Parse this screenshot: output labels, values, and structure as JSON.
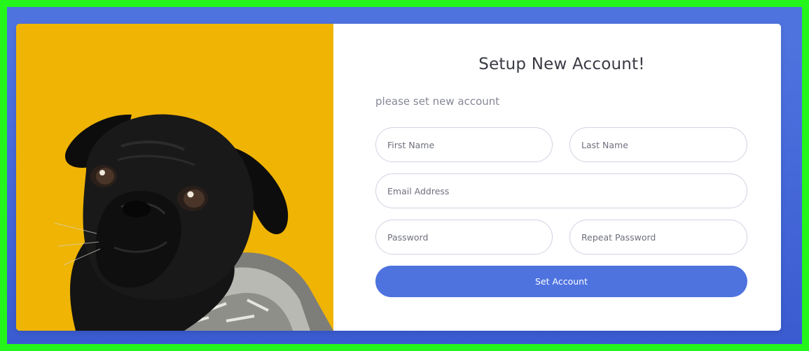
{
  "title": "Setup New Account!",
  "subtitle": "please set new account",
  "fields": {
    "first_name": "First Name",
    "last_name": "Last Name",
    "email": "Email Address",
    "password": "Password",
    "repeat_password": "Repeat Password"
  },
  "submit_label": "Set Account",
  "colors": {
    "accent": "#4e73df",
    "frame_border": "#24f51a",
    "photo_background": "#efb404"
  }
}
